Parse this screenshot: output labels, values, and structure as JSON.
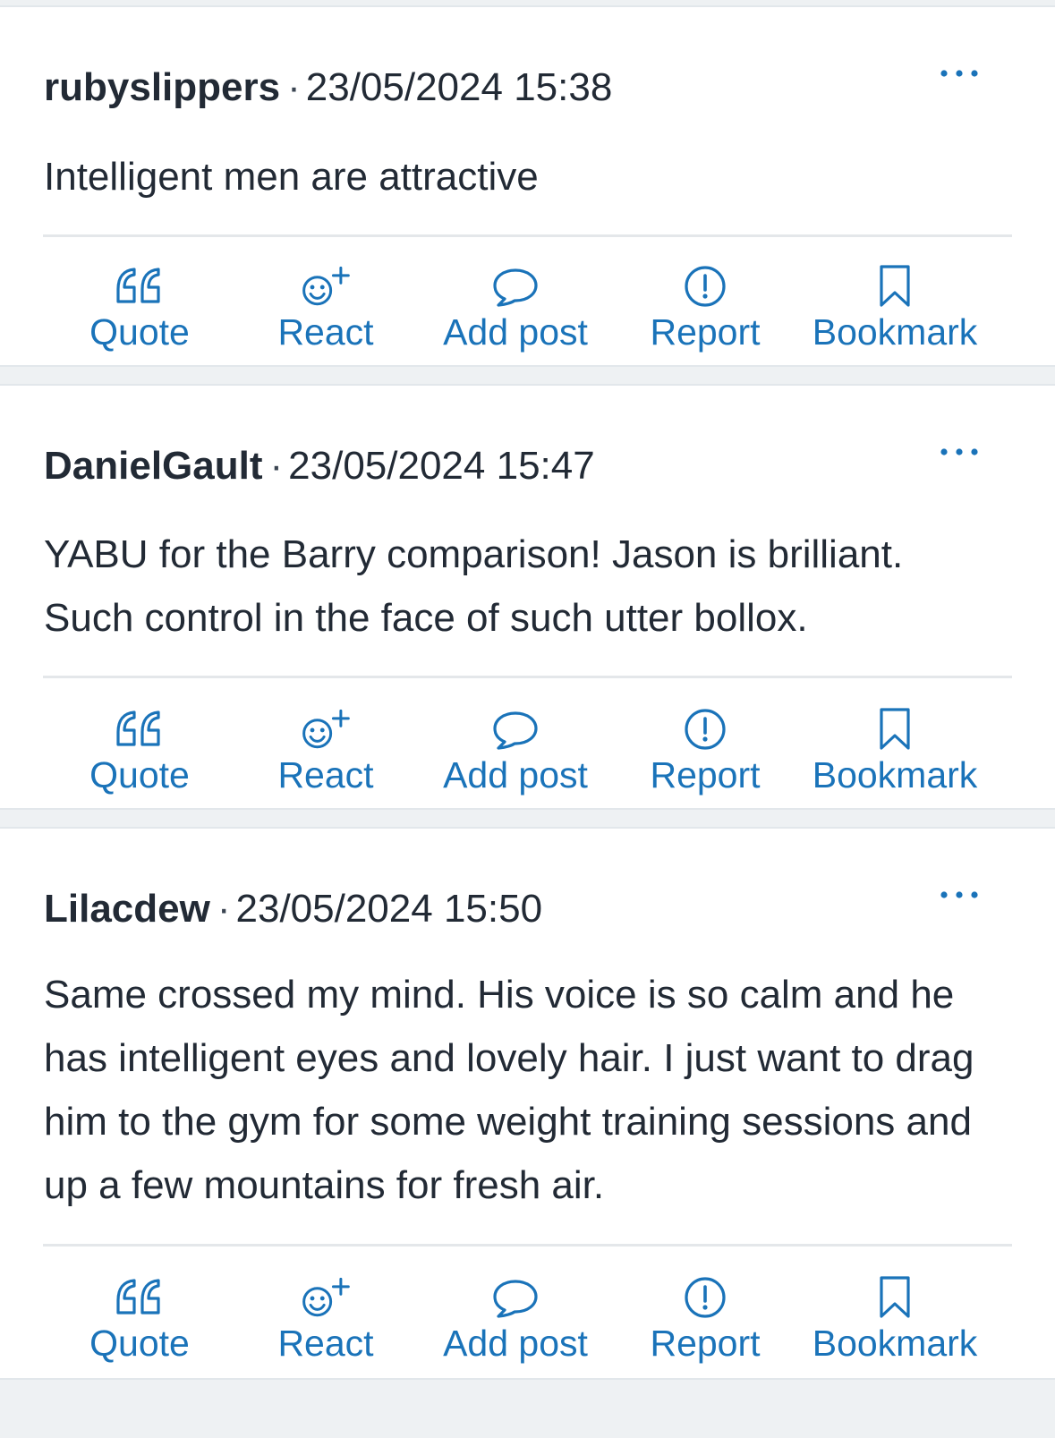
{
  "colors": {
    "accent": "#1a73b9",
    "text": "#222a35",
    "background": "#eef1f3",
    "card": "#ffffff",
    "divider": "#e4e7ea"
  },
  "separator": "·",
  "actions": [
    {
      "id": "quote",
      "label": "Quote",
      "icon": "quote-icon"
    },
    {
      "id": "react",
      "label": "React",
      "icon": "add-reaction-icon"
    },
    {
      "id": "addpost",
      "label": "Add post",
      "icon": "speech-bubble-icon"
    },
    {
      "id": "report",
      "label": "Report",
      "icon": "exclamation-circle-icon"
    },
    {
      "id": "bookmark",
      "label": "Bookmark",
      "icon": "bookmark-icon"
    }
  ],
  "posts": [
    {
      "username": "rubyslippers",
      "timestamp": "23/05/2024 15:38",
      "body": "Intelligent men are attractive",
      "more_icon": "more-options-icon"
    },
    {
      "username": "DanielGault",
      "timestamp": "23/05/2024 15:47",
      "body": "YABU for the Barry comparison! Jason is brilliant. Such control in the face of such utter bollox.",
      "more_icon": "more-options-icon"
    },
    {
      "username": "Lilacdew",
      "timestamp": "23/05/2024 15:50",
      "body": "Same crossed my mind. His voice is so calm and he has intelligent eyes and lovely hair. I just want to drag him to the gym for some weight training sessions and up a few mountains for fresh air.",
      "more_icon": "more-options-icon"
    }
  ]
}
